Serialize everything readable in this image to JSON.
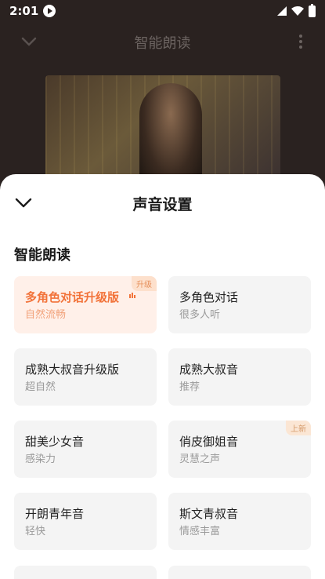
{
  "status_bar": {
    "time": "2:01"
  },
  "player": {
    "title": "智能朗读"
  },
  "sheet": {
    "title": "声音设置",
    "section_title": "智能朗读",
    "voices": [
      {
        "name": "多角色对话升级版",
        "desc": "自然流畅",
        "tag": "升级",
        "selected": true
      },
      {
        "name": "多角色对话",
        "desc": "很多人听",
        "tag": "",
        "selected": false
      },
      {
        "name": "成熟大叔音升级版",
        "desc": "超自然",
        "tag": "",
        "selected": false
      },
      {
        "name": "成熟大叔音",
        "desc": "推荐",
        "tag": "",
        "selected": false
      },
      {
        "name": "甜美少女音",
        "desc": "感染力",
        "tag": "",
        "selected": false
      },
      {
        "name": "俏皮御姐音",
        "desc": "灵慧之声",
        "tag": "上新",
        "selected": false
      },
      {
        "name": "开朗青年音",
        "desc": "轻快",
        "tag": "",
        "selected": false
      },
      {
        "name": "斯文青叔音",
        "desc": "情感丰富",
        "tag": "",
        "selected": false
      }
    ]
  },
  "colors": {
    "accent": "#f2733a",
    "selected_bg": "#fff0e9",
    "card_bg": "#f4f4f4",
    "backdrop": "#2a2220"
  }
}
